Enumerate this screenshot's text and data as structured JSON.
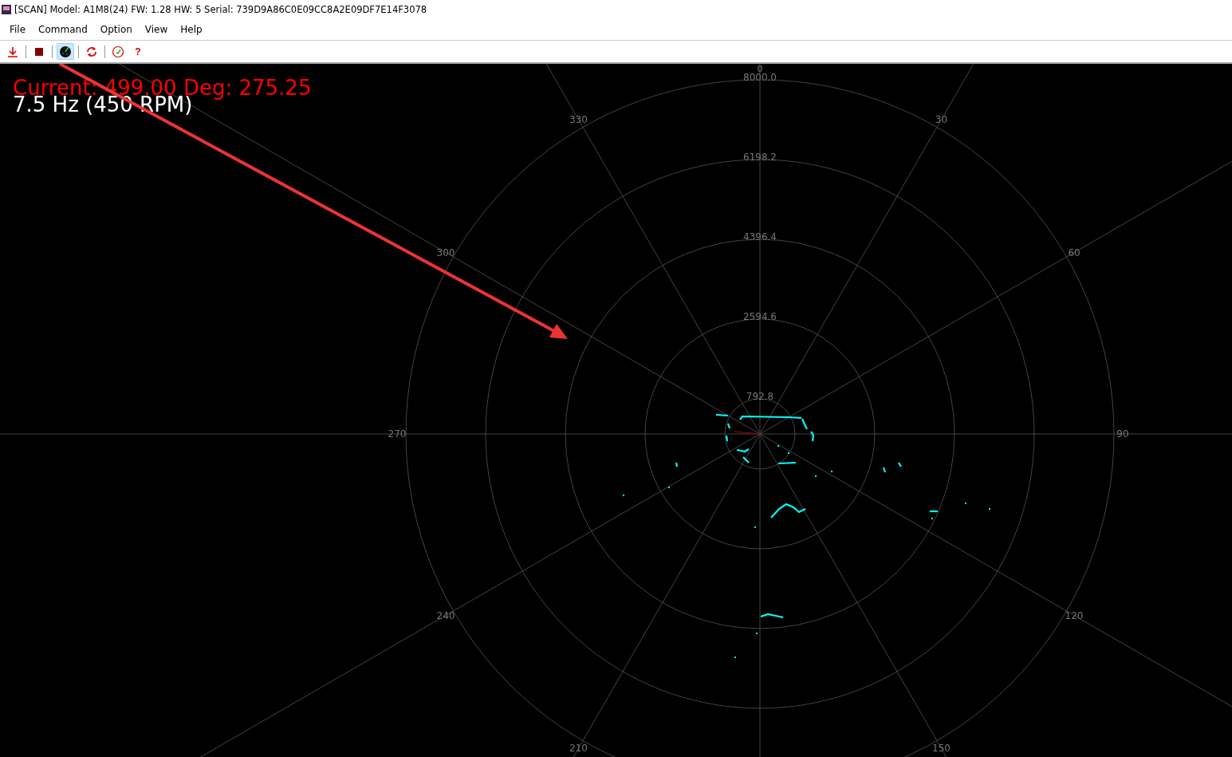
{
  "window": {
    "title": "[SCAN] Model: A1M8(24) FW: 1.28 HW: 5 Serial: 739D9A86C0E09CC8A2E09DF7E14F3078"
  },
  "menu": [
    "File",
    "Command",
    "Option",
    "View",
    "Help"
  ],
  "toolbar": [
    {
      "kind": "download",
      "selected": false
    },
    {
      "kind": "stop",
      "selected": false
    },
    {
      "kind": "radar",
      "selected": true
    },
    {
      "kind": "refresh",
      "selected": false
    },
    {
      "kind": "gauge",
      "selected": false
    },
    {
      "kind": "help",
      "label": "?",
      "selected": false
    }
  ],
  "readout": {
    "current": "Current: 499.00 Deg: 275.25",
    "frequency": "7.5 Hz (450 RPM)"
  },
  "plot": {
    "ring_labels": [
      "8000.0",
      "6198.2",
      "4396.4",
      "2594.6",
      "792.8"
    ],
    "angle_labels": [
      "0",
      "30",
      "60",
      "90",
      "120",
      "150",
      "210",
      "240",
      "270",
      "300",
      "330"
    ]
  }
}
